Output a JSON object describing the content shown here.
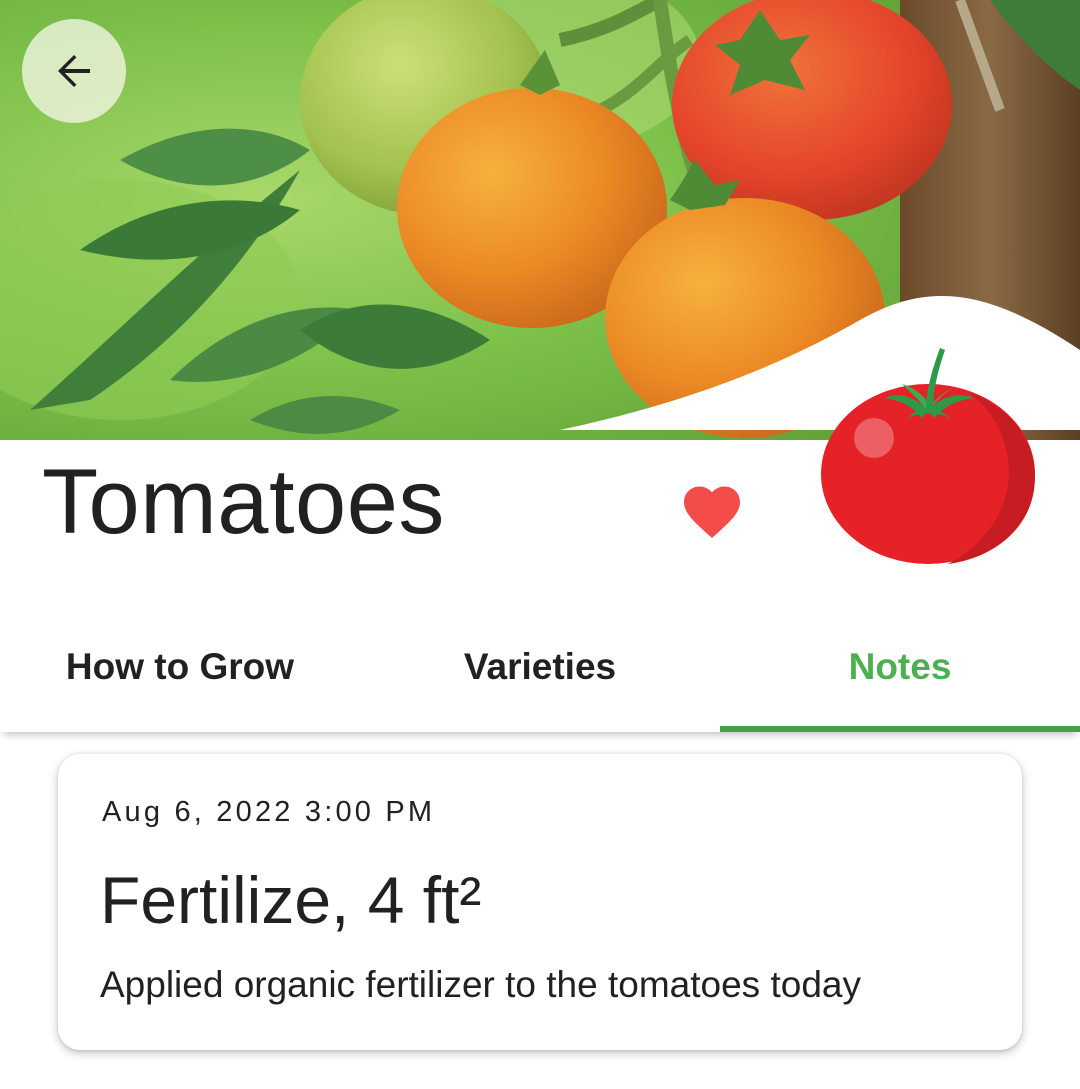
{
  "header": {
    "back_icon": "arrow-back-icon",
    "hero_image": "tomatoes-on-vine-photo",
    "title": "Tomatoes",
    "favorite_icon": "heart-icon",
    "plant_icon": "tomato-icon"
  },
  "tabs": [
    {
      "label": "How to Grow",
      "selected": false
    },
    {
      "label": "Varieties",
      "selected": false
    },
    {
      "label": "Notes",
      "selected": true
    }
  ],
  "notes": [
    {
      "date": "Aug 6, 2022 3:00 PM",
      "title": "Fertilize, 4 ft²",
      "body": "Applied organic fertilizer to the tomatoes today"
    }
  ],
  "colors": {
    "accent": "#4caf50",
    "indicator": "#43a047",
    "favorite": "#f44b4b",
    "text": "#212121"
  }
}
